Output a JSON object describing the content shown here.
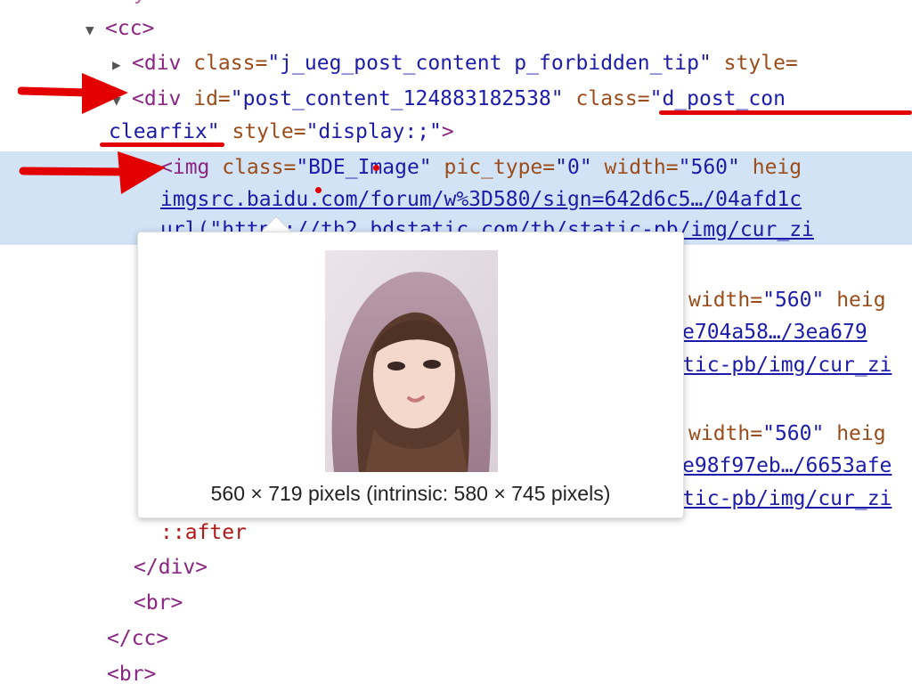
{
  "lines": {
    "cc_open": "<cc>",
    "div1_open": "<div",
    "div1_attr1_name": " class=",
    "div1_attr1_value": "\"j_ueg_post_content p_forbidden_tip\"",
    "div1_attr2_name": " style=",
    "div2_open": "<div",
    "div2_attr1_name": " id=",
    "div2_attr1_value": "\"post_content_124883182538\"",
    "div2_attr2_name": " class=",
    "div2_attr2_value": "\"d_post_con",
    "div2_cont_value": "clearfix",
    "div2_cont_quote": "\"",
    "div2_attr3_name": " style=",
    "div2_attr3_value": "\"display:;\"",
    "div2_close_bracket": ">",
    "img_open": "<img",
    "img_attr1_name": " class=",
    "img_attr1_value": "\"BDE_Image\"",
    "img_attr2_name": " pic_type=",
    "img_attr2_value": "\"0\"",
    "img_attr3_name": " width=",
    "img_attr3_value": "\"560\"",
    "img_attr4_name": " heig",
    "img_src_link": "imgsrc.baidu.com/forum/w%3D580/sign=642d6c5…/04afd1c",
    "img_url_partial": "url(\"https://th2.bdstatic.com/tb/static-pb/img/cur_zi",
    "img2_width_name": "width=",
    "img2_width_value": "\"560\"",
    "img2_heig": " heig",
    "img2_link": "e704a58…/3ea679",
    "img2_url": "tic-pb/img/cur_zi",
    "img3_width_name": "width=",
    "img3_width_value": "\"560\"",
    "img3_heig": " heig",
    "img3_link": "e98f97eb…/6653afe",
    "img3_url": "tic-pb/img/cur_zi",
    "after": "::after",
    "div_close": "</div>",
    "br1": "<br>",
    "cc_close": "</cc>",
    "br2": "<br>"
  },
  "popup": {
    "caption": "560 × 719 pixels (intrinsic: 580 × 745 pixels)"
  },
  "colors": {
    "tag": "#8a2581",
    "attr_name": "#9a4d1b",
    "attr_value": "#1c1caa",
    "selection": "#d3e3f6",
    "annotation": "#e30000"
  }
}
